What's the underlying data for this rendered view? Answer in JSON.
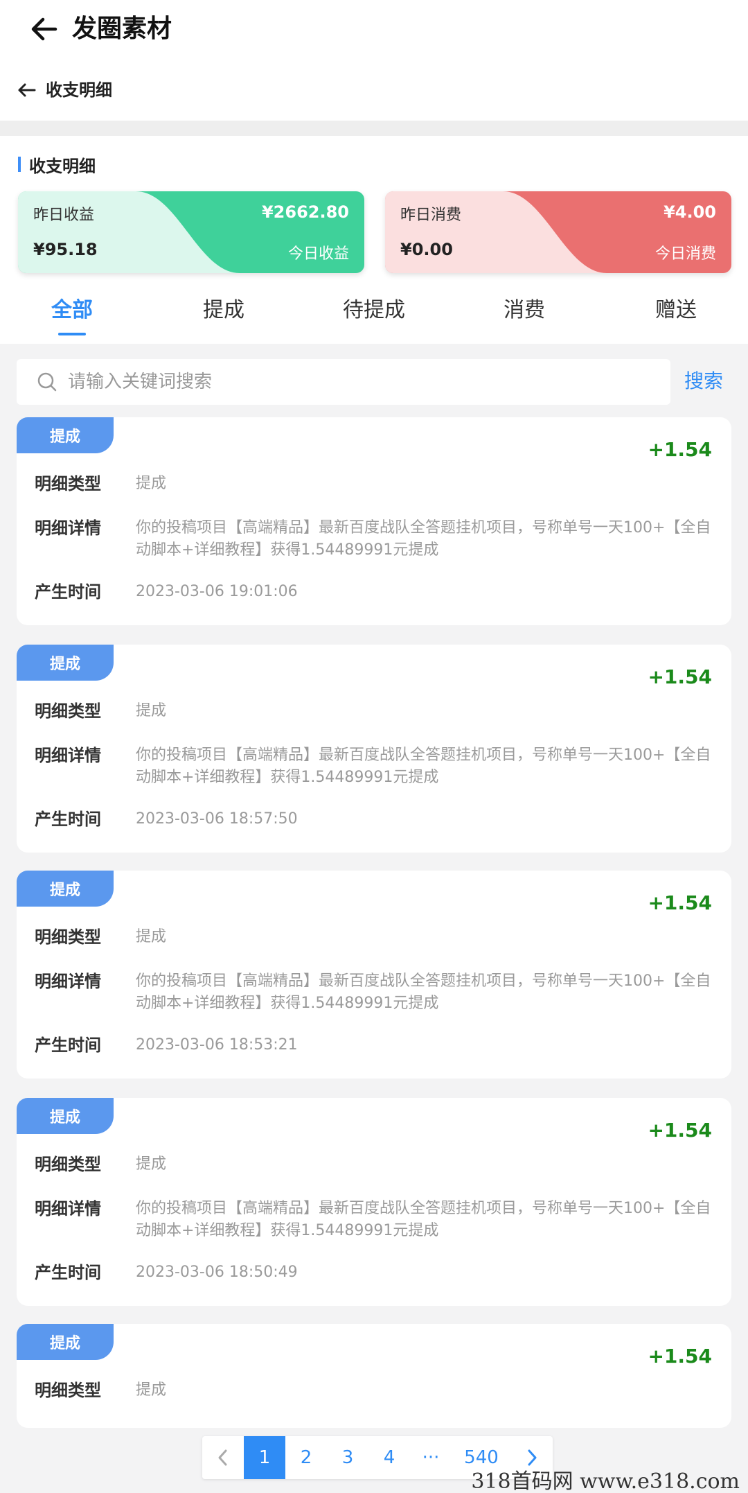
{
  "header": {
    "title": "发圈素材"
  },
  "subheader": {
    "title": "收支明细"
  },
  "section": {
    "title": "收支明细"
  },
  "cards": {
    "income": {
      "yesterday_label": "昨日收益",
      "yesterday_value": "¥95.18",
      "today_value": "¥2662.80",
      "today_label": "今日收益"
    },
    "expense": {
      "yesterday_label": "昨日消费",
      "yesterday_value": "¥0.00",
      "today_value": "¥4.00",
      "today_label": "今日消费"
    },
    "colors": {
      "income": "#3fd19a",
      "expense": "#ea7070"
    }
  },
  "tabs": [
    {
      "label": "全部",
      "active": true
    },
    {
      "label": "提成"
    },
    {
      "label": "待提成"
    },
    {
      "label": "消费"
    },
    {
      "label": "赠送"
    }
  ],
  "search": {
    "placeholder": "请输入关键词搜索",
    "button": "搜索"
  },
  "field_labels": {
    "type": "明细类型",
    "detail": "明细详情",
    "time": "产生时间"
  },
  "records": [
    {
      "tag": "提成",
      "amount": "+1.54",
      "type": "提成",
      "detail": "你的投稿项目【高端精品】最新百度战队全答题挂机项目，号称单号一天100+【全自动脚本+详细教程】获得1.54489991元提成",
      "time": "2023-03-06 19:01:06"
    },
    {
      "tag": "提成",
      "amount": "+1.54",
      "type": "提成",
      "detail": "你的投稿项目【高端精品】最新百度战队全答题挂机项目，号称单号一天100+【全自动脚本+详细教程】获得1.54489991元提成",
      "time": "2023-03-06 18:57:50"
    },
    {
      "tag": "提成",
      "amount": "+1.54",
      "type": "提成",
      "detail": "你的投稿项目【高端精品】最新百度战队全答题挂机项目，号称单号一天100+【全自动脚本+详细教程】获得1.54489991元提成",
      "time": "2023-03-06 18:53:21"
    },
    {
      "tag": "提成",
      "amount": "+1.54",
      "type": "提成",
      "detail": "你的投稿项目【高端精品】最新百度战队全答题挂机项目，号称单号一天100+【全自动脚本+详细教程】获得1.54489991元提成",
      "time": "2023-03-06 18:50:49"
    },
    {
      "tag": "提成",
      "amount": "+1.54",
      "type": "提成",
      "detail": "",
      "time": ""
    }
  ],
  "pagination": {
    "pages": [
      "1",
      "2",
      "3",
      "4"
    ],
    "ellipsis": "···",
    "last": "540",
    "current": "1"
  },
  "watermark": "318首码网  www.e318.com",
  "icons": {
    "back": "arrow-left-icon",
    "search": "search-icon",
    "prev": "chevron-left-icon",
    "next": "chevron-right-icon"
  }
}
